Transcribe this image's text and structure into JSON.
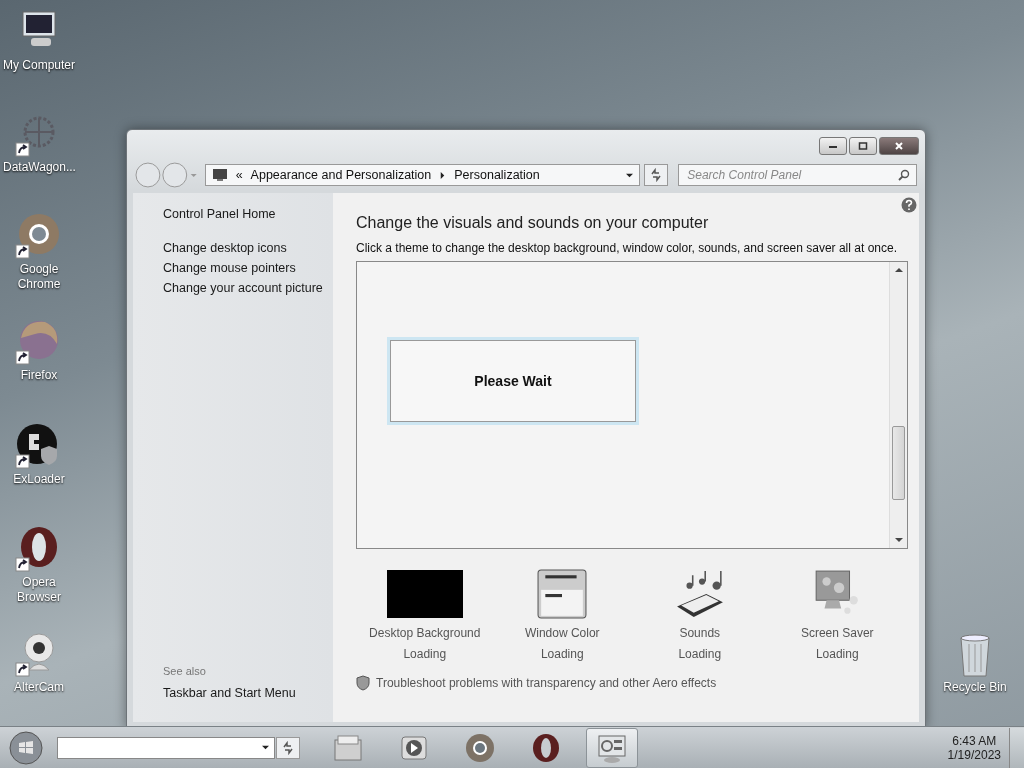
{
  "desktop_icons": [
    {
      "label": "My Computer",
      "kind": "computer",
      "shortcut": false
    },
    {
      "label": "DataWagon...",
      "kind": "network",
      "shortcut": true
    },
    {
      "label": "Google Chrome",
      "kind": "browser-ring",
      "shortcut": true
    },
    {
      "label": "Firefox",
      "kind": "fox",
      "shortcut": true
    },
    {
      "label": "ExLoader",
      "kind": "loader",
      "shortcut": true
    },
    {
      "label": "Opera Browser",
      "kind": "opera",
      "shortcut": true
    },
    {
      "label": "AlterCam",
      "kind": "webcam",
      "shortcut": true
    }
  ],
  "recycle_bin": {
    "label": "Recycle Bin"
  },
  "window": {
    "address": {
      "overflow": "«",
      "breadcrumb": [
        "Appearance and Personalization",
        "Personalization"
      ]
    },
    "search": {
      "placeholder": "Search Control Panel"
    },
    "sidebar": {
      "home": "Control Panel Home",
      "links": [
        "Change desktop icons",
        "Change mouse pointers",
        "Change your account picture"
      ],
      "see_also_title": "See also",
      "see_also": [
        "Taskbar and Start Menu"
      ]
    },
    "heading": "Change the visuals and sounds on your computer",
    "subheading": "Click a theme to change the desktop background, window color, sounds, and screen saver all at once.",
    "dialog": {
      "text": "Please Wait"
    },
    "settings": [
      {
        "kind": "background",
        "label": "Desktop Background",
        "status": "Loading"
      },
      {
        "kind": "color",
        "label": "Window Color",
        "status": "Loading"
      },
      {
        "kind": "sounds",
        "label": "Sounds",
        "status": "Loading"
      },
      {
        "kind": "screensaver",
        "label": "Screen Saver",
        "status": "Loading"
      }
    ],
    "troubleshoot": "Troubleshoot problems with transparency and other Aero effects"
  },
  "taskbar": {
    "pinned": [
      {
        "kind": "folder",
        "selected": false
      },
      {
        "kind": "media",
        "selected": false
      },
      {
        "kind": "ring",
        "selected": false
      },
      {
        "kind": "opera",
        "selected": false
      },
      {
        "kind": "control-panel",
        "selected": true
      }
    ],
    "clock": {
      "time": "6:43 AM",
      "date": "1/19/2023"
    }
  }
}
